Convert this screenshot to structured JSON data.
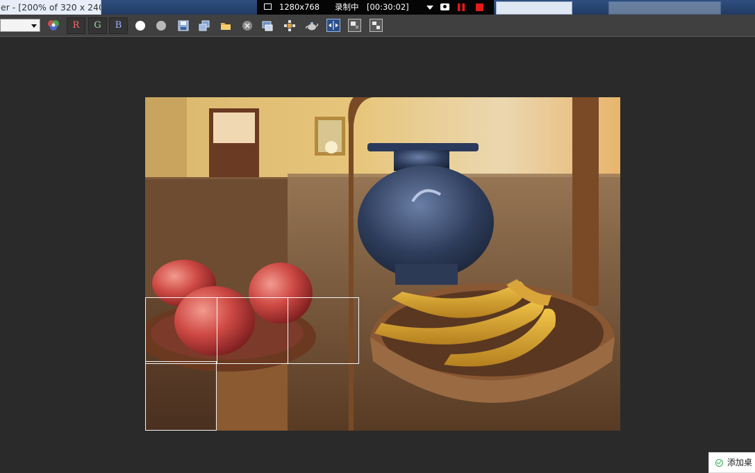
{
  "window": {
    "title": "er - [200% of 320 x 240]"
  },
  "recorder": {
    "resolution": "1280x768",
    "status": "录制中",
    "timer": "[00:30:02]"
  },
  "toolbar": {
    "channel_dropdown_value": "",
    "red_channel": "R",
    "green_channel": "G",
    "blue_channel": "B",
    "icons": [
      "color-channels-icon",
      "white-circle-icon",
      "gray-circle-icon",
      "save-icon",
      "clone-window-icon",
      "open-folder-icon",
      "clear-icon",
      "print-icon",
      "render-setup-icon",
      "teapot-render-icon",
      "split-view-icon",
      "region-render-icon",
      "crop-render-icon"
    ]
  },
  "notification": {
    "text": "添加桌"
  },
  "colors": {
    "toolbar_bg": "#404040",
    "viewport_bg": "#2a2a2a",
    "recorder_bg": "#050505",
    "record_red": "#e21b1b"
  }
}
